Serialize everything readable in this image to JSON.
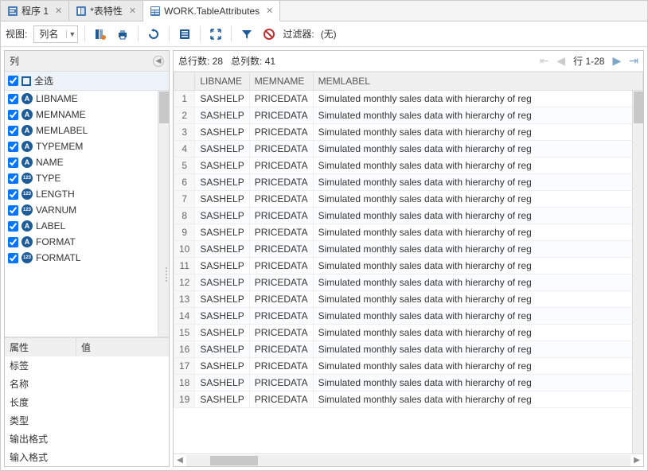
{
  "tabs": [
    {
      "label": "程序 1",
      "icon": "program-icon"
    },
    {
      "label": "*表特性",
      "icon": "properties-icon"
    },
    {
      "label": "WORK.TableAttributes",
      "icon": "table-icon",
      "active": true
    }
  ],
  "toolbar": {
    "view_label": "视图:",
    "view_value": "列名",
    "filter_label": "过滤器:",
    "filter_value": "(无)"
  },
  "left_panel": {
    "title": "列",
    "select_all": "全选",
    "columns": [
      {
        "name": "LIBNAME",
        "type": "A"
      },
      {
        "name": "MEMNAME",
        "type": "A"
      },
      {
        "name": "MEMLABEL",
        "type": "A"
      },
      {
        "name": "TYPEMEM",
        "type": "A"
      },
      {
        "name": "NAME",
        "type": "A"
      },
      {
        "name": "TYPE",
        "type": "123"
      },
      {
        "name": "LENGTH",
        "type": "123"
      },
      {
        "name": "VARNUM",
        "type": "123"
      },
      {
        "name": "LABEL",
        "type": "A"
      },
      {
        "name": "FORMAT",
        "type": "A"
      },
      {
        "name": "FORMATL",
        "type": "123"
      }
    ],
    "props_header": {
      "attr": "属性",
      "val": "值"
    },
    "props": [
      "标签",
      "名称",
      "长度",
      "类型",
      "输出格式",
      "输入格式"
    ]
  },
  "status": {
    "total_rows_label": "总行数:",
    "total_rows": "28",
    "total_cols_label": "总列数:",
    "total_cols": "41",
    "range": "行 1-28"
  },
  "grid": {
    "headers": [
      "LIBNAME",
      "MEMNAME",
      "MEMLABEL"
    ],
    "row": {
      "lib": "SASHELP",
      "mem": "PRICEDATA",
      "label": "Simulated monthly sales data with hierarchy of reg"
    },
    "row_count": 19
  }
}
